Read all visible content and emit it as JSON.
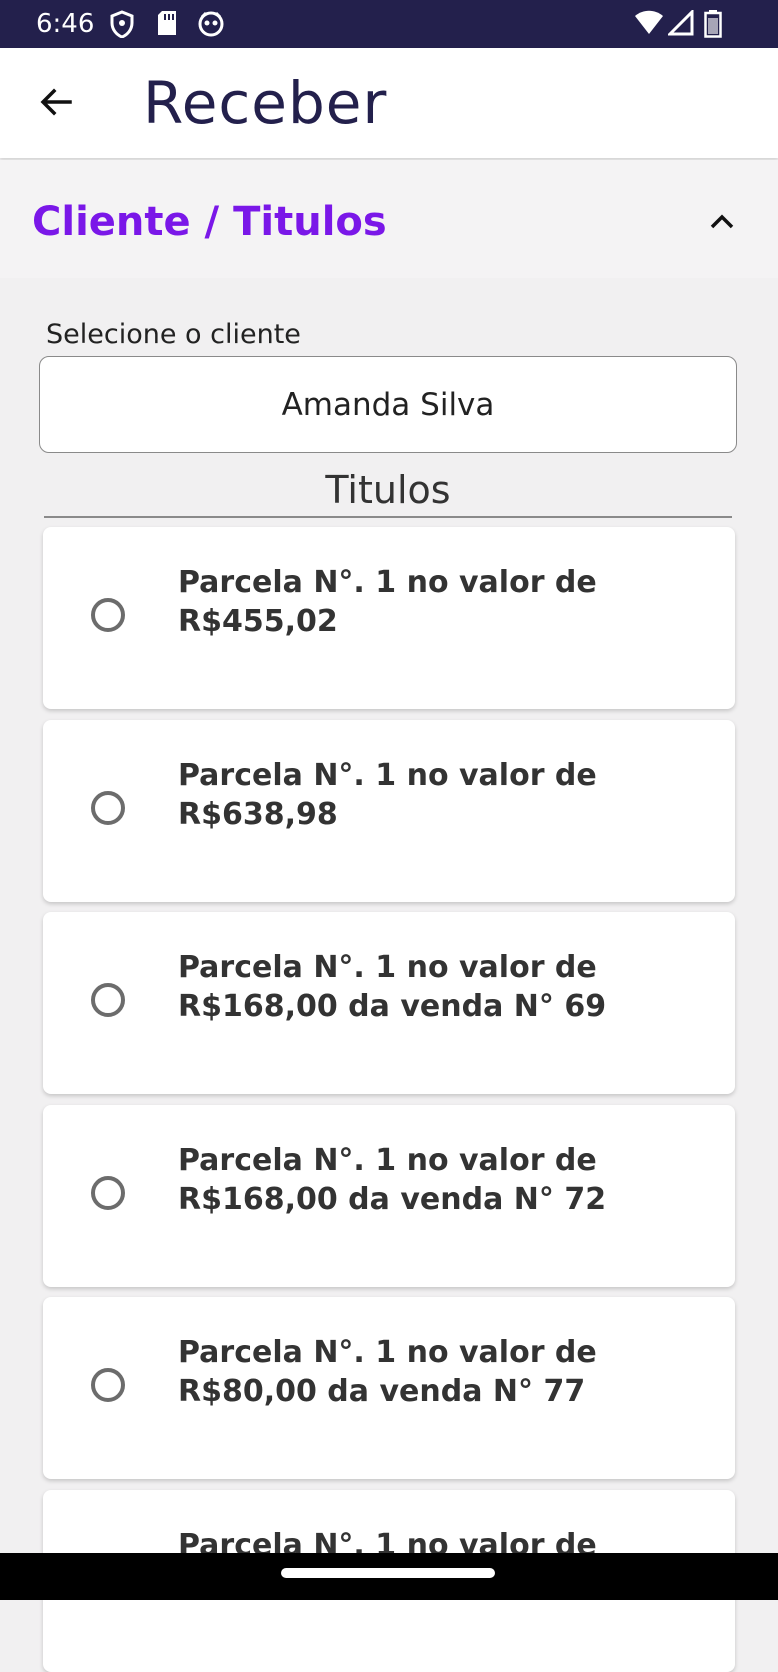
{
  "status_bar": {
    "time": "6:46",
    "left_icons": [
      "shield-icon",
      "sd-card-icon",
      "face-icon"
    ],
    "right_icons": [
      "wifi-icon",
      "signal-icon",
      "battery-icon"
    ]
  },
  "app_bar": {
    "title": "Receber",
    "back_icon": "arrow-left-icon"
  },
  "section": {
    "title": "Cliente / Titulos",
    "collapse_icon": "chevron-up-icon"
  },
  "client": {
    "label": "Selecione o cliente",
    "selected": "Amanda Silva"
  },
  "titulos": {
    "heading": "Titulos",
    "items": [
      {
        "text": "Parcela N°. 1 no valor de\nR$455,02",
        "selected": false
      },
      {
        "text": "Parcela N°. 1 no valor de\nR$638,98",
        "selected": false
      },
      {
        "text": "Parcela N°. 1 no valor de\nR$168,00 da venda N° 69",
        "selected": false
      },
      {
        "text": "Parcela N°. 1 no valor de\nR$168,00 da venda N° 72",
        "selected": false
      },
      {
        "text": "Parcela N°. 1 no valor de\nR$80,00 da venda N° 77",
        "selected": false
      },
      {
        "text": "Parcela N°. 1 no valor de",
        "selected": false
      }
    ]
  },
  "colors": {
    "status_bar": "#23204c",
    "accent": "#7a17e8",
    "title": "#23204c"
  }
}
